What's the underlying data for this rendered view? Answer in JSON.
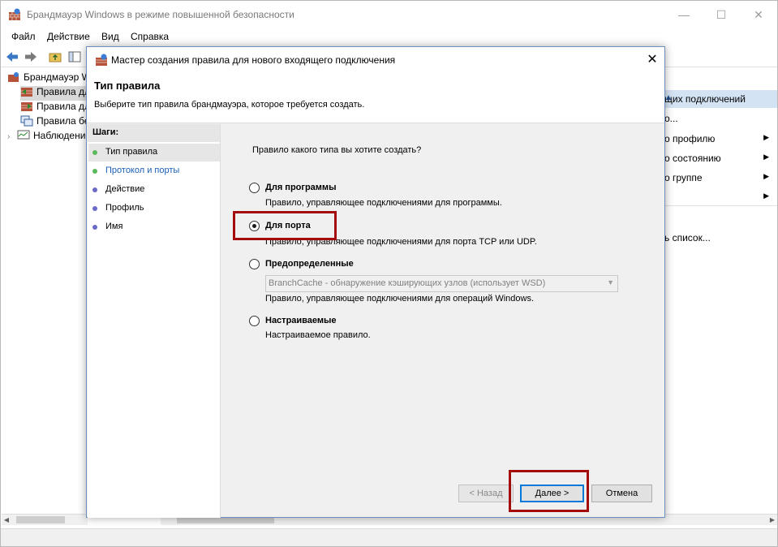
{
  "main": {
    "title": "Брандмауэр Windows в режиме повышенной безопасности",
    "window_controls": {
      "minimize": "—",
      "maximize": "☐",
      "close": "✕"
    },
    "menu": [
      "Файл",
      "Действие",
      "Вид",
      "Справка"
    ],
    "tree": [
      {
        "label": "Брандмауэр Windows",
        "selected": false
      },
      {
        "label": "Правила для входящих",
        "selected": true
      },
      {
        "label": "Правила для исходящих",
        "selected": false
      },
      {
        "label": "Правила безопасности",
        "selected": false
      },
      {
        "label": "Наблюдение",
        "selected": false
      }
    ],
    "actions": {
      "header": "щих подключений",
      "items": [
        {
          "label": "о...",
          "arrow": false
        },
        {
          "label": "о профилю",
          "arrow": true
        },
        {
          "label": "о состоянию",
          "arrow": true
        },
        {
          "label": "о группе",
          "arrow": true
        },
        {
          "label": "",
          "arrow": true
        },
        {
          "label": "",
          "arrow": false
        },
        {
          "label": "ь список...",
          "arrow": false
        }
      ]
    }
  },
  "dialog": {
    "title": "Мастер создания правила для нового входящего подключения",
    "close": "✕",
    "header_title": "Тип правила",
    "header_desc": "Выберите тип правила брандмауэра, которое требуется создать.",
    "steps_header": "Шаги:",
    "steps": [
      {
        "label": "Тип правила",
        "current": true,
        "dot_color": "#5cb85c",
        "label_color": "#000000"
      },
      {
        "label": "Протокол и порты",
        "current": false,
        "dot_color": "#5cb85c",
        "label_color": "#1a5fb4"
      },
      {
        "label": "Действие",
        "current": false,
        "dot_color": "#6b6bc7",
        "label_color": "#000000"
      },
      {
        "label": "Профиль",
        "current": false,
        "dot_color": "#6b6bc7",
        "label_color": "#000000"
      },
      {
        "label": "Имя",
        "current": false,
        "dot_color": "#6b6bc7",
        "label_color": "#000000"
      }
    ],
    "question": "Правило какого типа вы хотите создать?",
    "options": [
      {
        "label": "Для программы",
        "desc": "Правило, управляющее подключениями для программы.",
        "selected": false
      },
      {
        "label": "Для порта",
        "desc": "Правило, управляющее подключениями для порта TCP или UDP.",
        "selected": true
      },
      {
        "label": "Предопределенные",
        "desc": "Правило, управляющее подключениями для операций Windows.",
        "selected": false
      },
      {
        "label": "Настраиваемые",
        "desc": "Настраиваемое правило.",
        "selected": false
      }
    ],
    "predefined_combo": "BranchCache - обнаружение кэширующих узлов (использует WSD)",
    "buttons": {
      "back": "< Назад",
      "next": "Далее >",
      "cancel": "Отмена"
    }
  },
  "colors": {
    "highlight": "#a40b0b",
    "accent": "#0078d7",
    "actions_header": "#d4e3f4"
  }
}
